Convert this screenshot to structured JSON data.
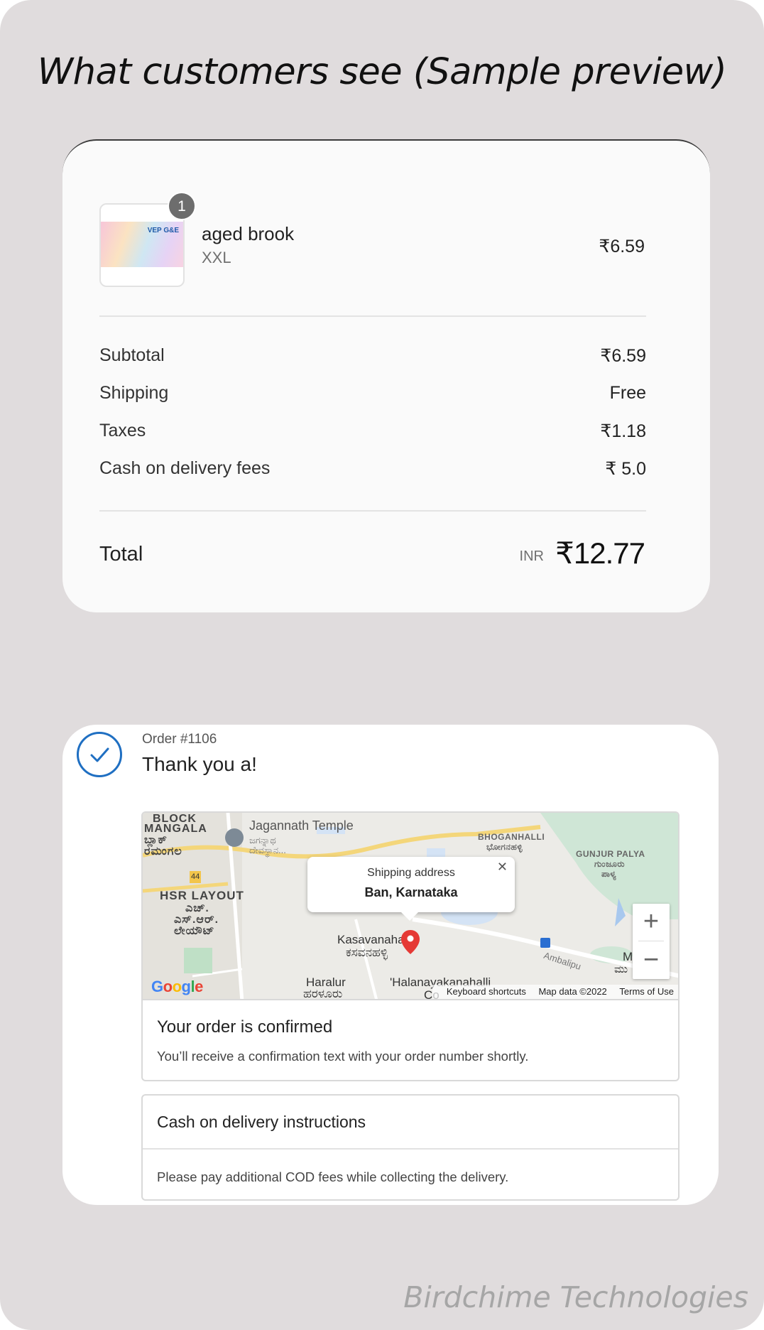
{
  "headline": "What customers see (Sample preview)",
  "summary": {
    "item": {
      "quantity": "1",
      "name": "aged brook",
      "variant": "XXL",
      "price": "₹6.59",
      "thumb_label": "VEP G&E"
    },
    "rows": [
      {
        "label": "Subtotal",
        "value": "₹6.59"
      },
      {
        "label": "Shipping",
        "value": "Free"
      },
      {
        "label": "Taxes",
        "value": "₹1.18"
      },
      {
        "label": "Cash on delivery fees",
        "value": "₹ 5.0"
      }
    ],
    "total": {
      "label": "Total",
      "currency": "INR",
      "value": "₹12.77"
    }
  },
  "thanks": {
    "order_number": "Order #1106",
    "title": "Thank you a!",
    "check_icon": "check-circle-icon",
    "accent_color": "#1f6fc2",
    "map": {
      "popup_title": "Shipping address",
      "popup_address": "Ban, Karnataka",
      "labels": {
        "block": "BLOCK",
        "mangala": "MANGALA",
        "mangala_kn": "ಬ್ಲಾಕ್",
        "mangala_kn2": "ರಮಂಗಲ",
        "temple": "Jagannath Temple",
        "temple_kn": "ಜಗನ್ನಾಥ",
        "temple_kn2": "ದೇವಸ್ಥಾನ...",
        "hsr": "HSR LAYOUT",
        "hsr_kn1": "ಎಚ್.",
        "hsr_kn2": "ಎಸ್.ಆರ್.",
        "hsr_kn3": "ಲೇಯೌಟ್",
        "bhoganhalli": "BHOGANHALLI",
        "bhoganhalli_kn": "ಭೋಗನಹಳ್ಳಿ",
        "gunjur": "GUNJUR PALYA",
        "gunjur_kn": "ಗುಂಜೂರು",
        "gunjur_kn2": "ಪಾಳ್ಯ",
        "kasavanahalli": "Kasavanahalli",
        "kasavanahalli_kn": "ಕಸವನಹಳ್ಳಿ",
        "haralur": "Haralur",
        "haralur_kn": "ಹರಳೂರು",
        "halanayakanahalli": "'Halanayakanahalli",
        "co": "Co",
        "ambalipura": "Ambalipu",
        "mu": "Mu",
        "mu_kn": "ಮು",
        "highway": "44"
      },
      "zoom_in": "+",
      "zoom_out": "−",
      "google": "Google",
      "footer": {
        "shortcuts": "Keyboard shortcuts",
        "map_data": "Map data ©2022",
        "terms": "Terms of Use"
      }
    },
    "confirm": {
      "title": "Your order is confirmed",
      "text": "You’ll receive a confirmation text with your order number shortly."
    },
    "cod": {
      "title": "Cash on delivery instructions",
      "text": "Please pay additional COD fees while collecting the delivery."
    }
  },
  "watermark": "Birdchime Technologies"
}
